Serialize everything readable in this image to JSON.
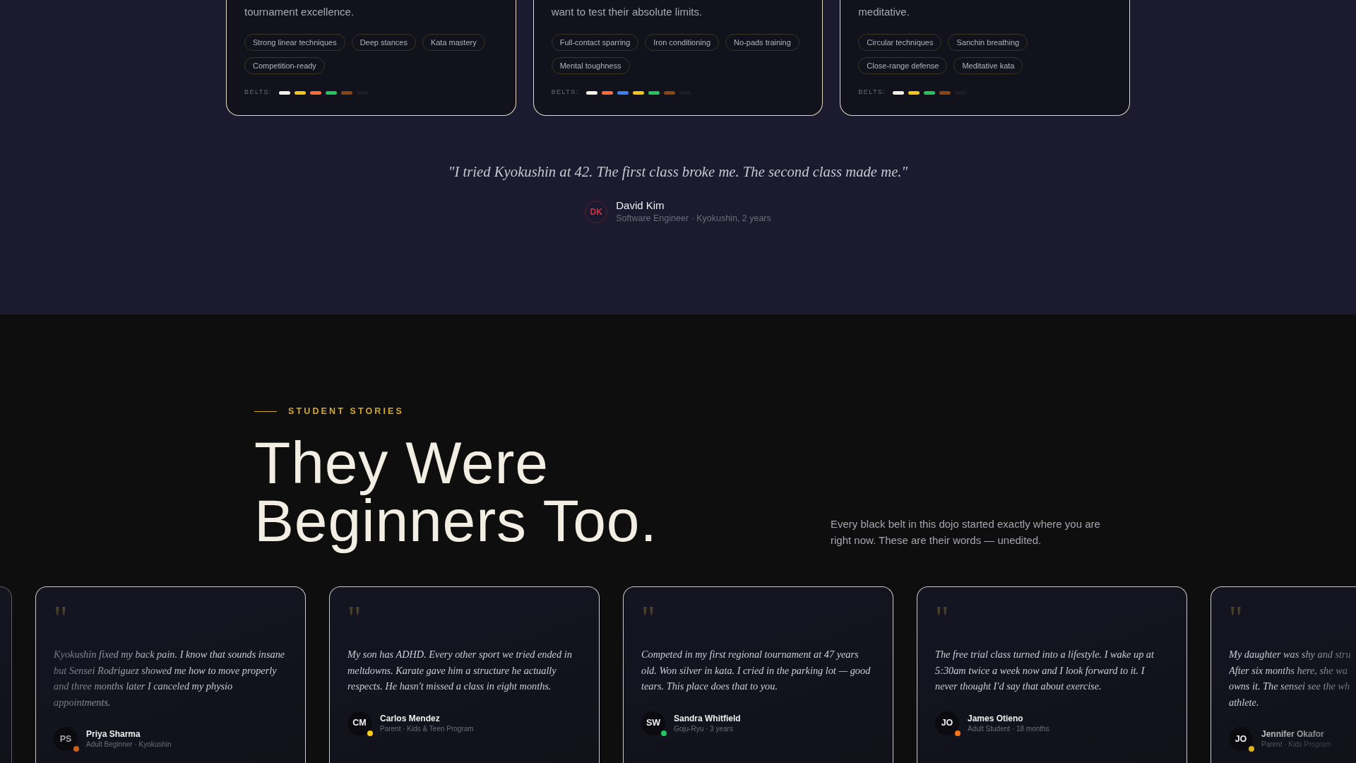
{
  "discipline_cards": [
    {
      "description": "tournament excellence.",
      "tags": [
        "Strong linear techniques",
        "Deep stances",
        "Kata mastery",
        "Competition-ready"
      ],
      "belts_label": "BELTS:",
      "belts": [
        {
          "color": "#f5f0e6"
        },
        {
          "color": "#f5c518"
        },
        {
          "color": "#ff6b35"
        },
        {
          "color": "#22c55e"
        },
        {
          "color": "#8b4513"
        },
        {
          "color": "#1c1c22"
        }
      ]
    },
    {
      "description": "want to test their absolute limits.",
      "tags": [
        "Full-contact sparring",
        "Iron conditioning",
        "No-pads training",
        "Mental toughness"
      ],
      "belts_label": "BELTS:",
      "belts": [
        {
          "color": "#f5f0e6"
        },
        {
          "color": "#ff6b35"
        },
        {
          "color": "#3b82f6"
        },
        {
          "color": "#f5c518"
        },
        {
          "color": "#22c55e"
        },
        {
          "color": "#8b4513"
        },
        {
          "color": "#1c1c22"
        }
      ]
    },
    {
      "description": "meditative.",
      "tags": [
        "Circular techniques",
        "Sanchin breathing",
        "Close-range defense",
        "Meditative kata"
      ],
      "belts_label": "BELTS:",
      "belts": [
        {
          "color": "#f5f0e6"
        },
        {
          "color": "#f5c518"
        },
        {
          "color": "#22c55e"
        },
        {
          "color": "#8b4513"
        },
        {
          "color": "#1c1c22"
        }
      ]
    }
  ],
  "featured_quote": {
    "text": "\"I tried Kyokushin at 42. The first class broke me. The second class made me.\"",
    "author": {
      "initials": "DK",
      "name": "David Kim",
      "detail": "Software Engineer · Kyokushin, 2 years"
    }
  },
  "stories": {
    "eyebrow": "STUDENT STORIES",
    "heading": "They Were Beginners Too.",
    "intro": "Every black belt in this dojo started exactly where you are right now. These are their words — unedited."
  },
  "testimonials": [
    {
      "kind": "sliver"
    },
    {
      "kind": "faded",
      "quote_mark": "\"",
      "quote": "Kyokushin fixed my back pain. I know that sounds insane but Sensei Rodriguez showed me how to move properly and three months later I canceled my physio appointments.",
      "initials": "PS",
      "name": "Priya Sharma",
      "detail": "Adult Beginner · Kyokushin",
      "color": "#c8601e"
    },
    {
      "kind": "full",
      "quote_mark": "\"",
      "quote": "My son has ADHD. Every other sport we tried ended in meltdowns. Karate gave him a structure he actually respects. He hasn't missed a class in eight months.",
      "initials": "CM",
      "name": "Carlos Mendez",
      "detail": "Parent · Kids & Teen Program",
      "color": "#facc15"
    },
    {
      "kind": "full",
      "quote_mark": "\"",
      "quote": "Competed in my first regional tournament at 47 years old. Won silver in kata. I cried in the parking lot — good tears. This place does that to you.",
      "initials": "SW",
      "name": "Sandra Whitfield",
      "detail": "Goju-Ryu · 3 years",
      "color": "#22c55e"
    },
    {
      "kind": "full",
      "quote_mark": "\"",
      "quote": "The free trial class turned into a lifestyle. I wake up at 5:30am twice a week now and I look forward to it. I never thought I'd say that about exercise.",
      "initials": "JO",
      "name": "James Otieno",
      "detail": "Adult Student · 18 months",
      "color": "#f97316"
    },
    {
      "kind": "clipped",
      "quote_mark": "\"",
      "quote": "My daughter was shy and stru\nAfter six months here, she wa\nowns it. The sensei see the wh\nathlete.",
      "initials": "JO",
      "name": "Jennifer Okafor",
      "detail": "Parent · Kids Program",
      "color": "#dcb41c"
    }
  ]
}
